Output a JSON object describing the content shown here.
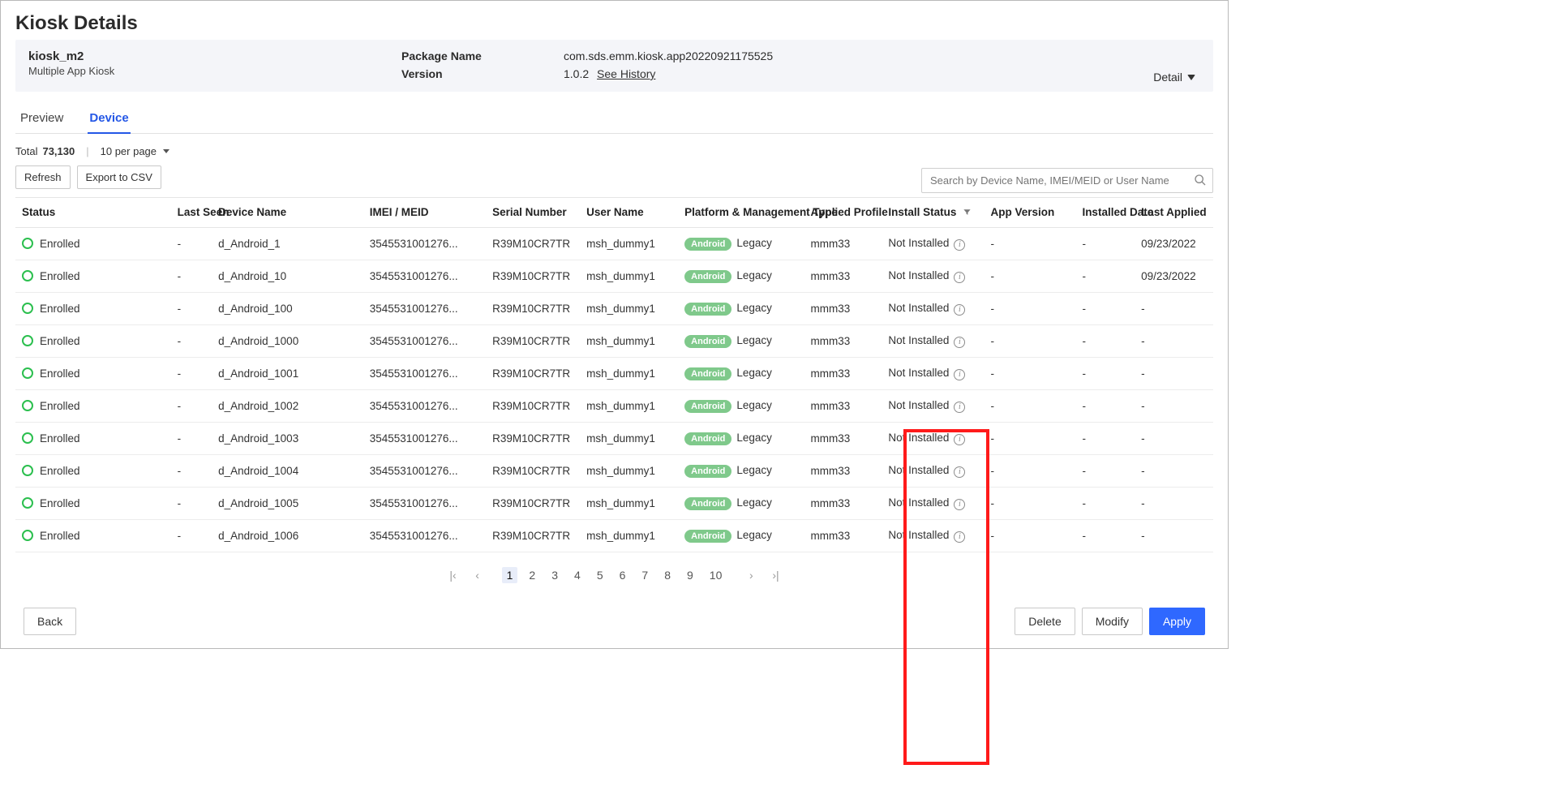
{
  "page_title": "Kiosk Details",
  "header": {
    "kiosk_name": "kiosk_m2",
    "kiosk_type": "Multiple App Kiosk",
    "package_name_label": "Package Name",
    "package_name_value": "com.sds.emm.kiosk.app20220921175525",
    "version_label": "Version",
    "version_value": "1.0.2",
    "see_history": "See History",
    "detail_label": "Detail"
  },
  "tabs": {
    "preview": "Preview",
    "device": "Device"
  },
  "toolbar": {
    "total_label": "Total",
    "total_value": "73,130",
    "per_page": "10 per page",
    "refresh": "Refresh",
    "export": "Export to CSV",
    "search_placeholder": "Search by Device Name, IMEI/MEID or User Name"
  },
  "columns": {
    "status": "Status",
    "last_seen": "Last Seen",
    "device_name": "Device Name",
    "imei": "IMEI / MEID",
    "serial": "Serial Number",
    "user": "User Name",
    "platform": "Platform & Management Type",
    "profile": "Applied Profile",
    "install": "Install Status",
    "app_ver": "App Version",
    "inst_date": "Installed Date",
    "last_applied": "Last Applied"
  },
  "platform_badge": "Android",
  "rows": [
    {
      "status": "Enrolled",
      "last": "-",
      "device": "d_Android_1",
      "imei": "3545531001276...",
      "serial": "R39M10CR7TR",
      "user": "msh_dummy1",
      "mgmt": "Legacy",
      "profile": "mmm33",
      "install": "Not Installed",
      "appver": "-",
      "instdate": "-",
      "lastapp": "09/23/2022"
    },
    {
      "status": "Enrolled",
      "last": "-",
      "device": "d_Android_10",
      "imei": "3545531001276...",
      "serial": "R39M10CR7TR",
      "user": "msh_dummy1",
      "mgmt": "Legacy",
      "profile": "mmm33",
      "install": "Not Installed",
      "appver": "-",
      "instdate": "-",
      "lastapp": "09/23/2022"
    },
    {
      "status": "Enrolled",
      "last": "-",
      "device": "d_Android_100",
      "imei": "3545531001276...",
      "serial": "R39M10CR7TR",
      "user": "msh_dummy1",
      "mgmt": "Legacy",
      "profile": "mmm33",
      "install": "Not Installed",
      "appver": "-",
      "instdate": "-",
      "lastapp": "-"
    },
    {
      "status": "Enrolled",
      "last": "-",
      "device": "d_Android_1000",
      "imei": "3545531001276...",
      "serial": "R39M10CR7TR",
      "user": "msh_dummy1",
      "mgmt": "Legacy",
      "profile": "mmm33",
      "install": "Not Installed",
      "appver": "-",
      "instdate": "-",
      "lastapp": "-"
    },
    {
      "status": "Enrolled",
      "last": "-",
      "device": "d_Android_1001",
      "imei": "3545531001276...",
      "serial": "R39M10CR7TR",
      "user": "msh_dummy1",
      "mgmt": "Legacy",
      "profile": "mmm33",
      "install": "Not Installed",
      "appver": "-",
      "instdate": "-",
      "lastapp": "-"
    },
    {
      "status": "Enrolled",
      "last": "-",
      "device": "d_Android_1002",
      "imei": "3545531001276...",
      "serial": "R39M10CR7TR",
      "user": "msh_dummy1",
      "mgmt": "Legacy",
      "profile": "mmm33",
      "install": "Not Installed",
      "appver": "-",
      "instdate": "-",
      "lastapp": "-"
    },
    {
      "status": "Enrolled",
      "last": "-",
      "device": "d_Android_1003",
      "imei": "3545531001276...",
      "serial": "R39M10CR7TR",
      "user": "msh_dummy1",
      "mgmt": "Legacy",
      "profile": "mmm33",
      "install": "Not Installed",
      "appver": "-",
      "instdate": "-",
      "lastapp": "-"
    },
    {
      "status": "Enrolled",
      "last": "-",
      "device": "d_Android_1004",
      "imei": "3545531001276...",
      "serial": "R39M10CR7TR",
      "user": "msh_dummy1",
      "mgmt": "Legacy",
      "profile": "mmm33",
      "install": "Not Installed",
      "appver": "-",
      "instdate": "-",
      "lastapp": "-"
    },
    {
      "status": "Enrolled",
      "last": "-",
      "device": "d_Android_1005",
      "imei": "3545531001276...",
      "serial": "R39M10CR7TR",
      "user": "msh_dummy1",
      "mgmt": "Legacy",
      "profile": "mmm33",
      "install": "Not Installed",
      "appver": "-",
      "instdate": "-",
      "lastapp": "-"
    },
    {
      "status": "Enrolled",
      "last": "-",
      "device": "d_Android_1006",
      "imei": "3545531001276...",
      "serial": "R39M10CR7TR",
      "user": "msh_dummy1",
      "mgmt": "Legacy",
      "profile": "mmm33",
      "install": "Not Installed",
      "appver": "-",
      "instdate": "-",
      "lastapp": "-"
    }
  ],
  "pager": {
    "pages": [
      "1",
      "2",
      "3",
      "4",
      "5",
      "6",
      "7",
      "8",
      "9",
      "10"
    ],
    "active": "1"
  },
  "footer": {
    "back": "Back",
    "delete": "Delete",
    "modify": "Modify",
    "apply": "Apply"
  }
}
